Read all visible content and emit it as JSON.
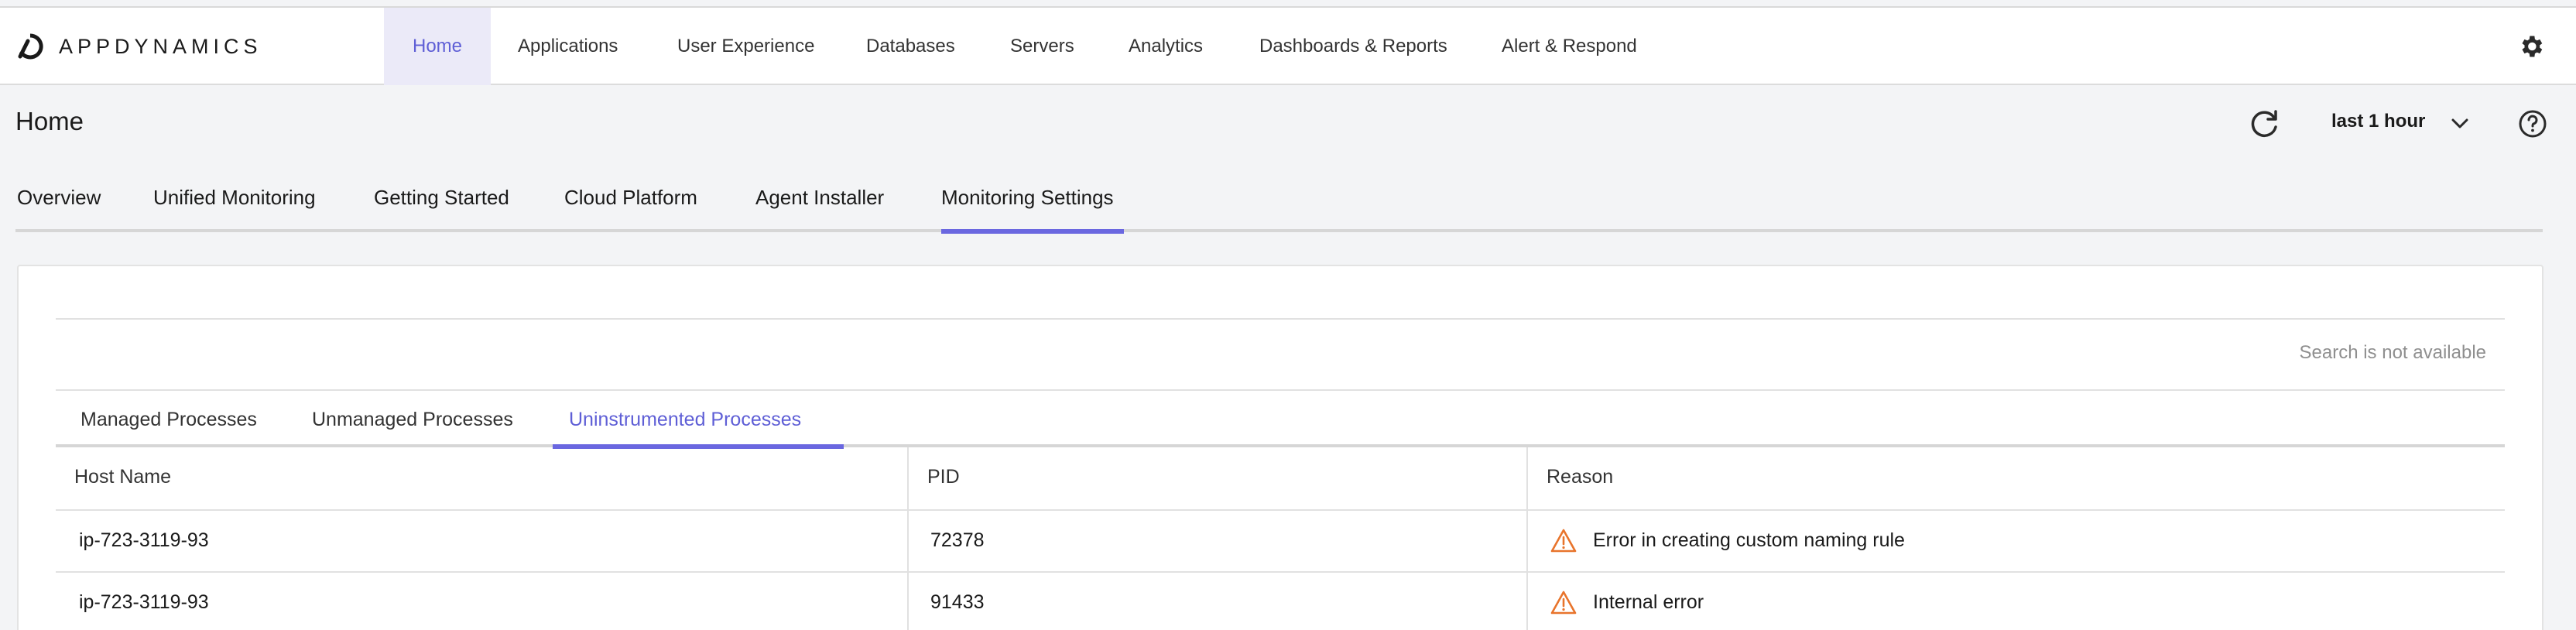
{
  "brand": {
    "name": "APPDYNAMICS"
  },
  "topnav": {
    "items": [
      {
        "label": "Home",
        "active": true
      },
      {
        "label": "Applications"
      },
      {
        "label": "User Experience"
      },
      {
        "label": "Databases"
      },
      {
        "label": "Servers"
      },
      {
        "label": "Analytics"
      },
      {
        "label": "Dashboards & Reports"
      },
      {
        "label": "Alert & Respond"
      }
    ]
  },
  "header": {
    "title": "Home",
    "time_range": "last 1 hour"
  },
  "tabs": [
    {
      "label": "Overview"
    },
    {
      "label": "Unified Monitoring"
    },
    {
      "label": "Getting Started"
    },
    {
      "label": "Cloud Platform"
    },
    {
      "label": "Agent Installer"
    },
    {
      "label": "Monitoring Settings",
      "active": true
    }
  ],
  "search": {
    "note": "Search is not available"
  },
  "subtabs": [
    {
      "label": "Managed Processes"
    },
    {
      "label": "Unmanaged Processes"
    },
    {
      "label": "Uninstrumented Processes",
      "active": true
    }
  ],
  "table": {
    "columns": [
      "Host Name",
      "PID",
      "Reason"
    ],
    "rows": [
      {
        "host": "ip-723-3119-93",
        "pid": "72378",
        "reason": "Error in creating custom naming rule"
      },
      {
        "host": "ip-723-3119-93",
        "pid": "91433",
        "reason": "Internal error"
      }
    ]
  },
  "colors": {
    "accent": "#6a67e0",
    "active_nav_bg": "#ebeaf8",
    "warning": "#e8742c"
  }
}
